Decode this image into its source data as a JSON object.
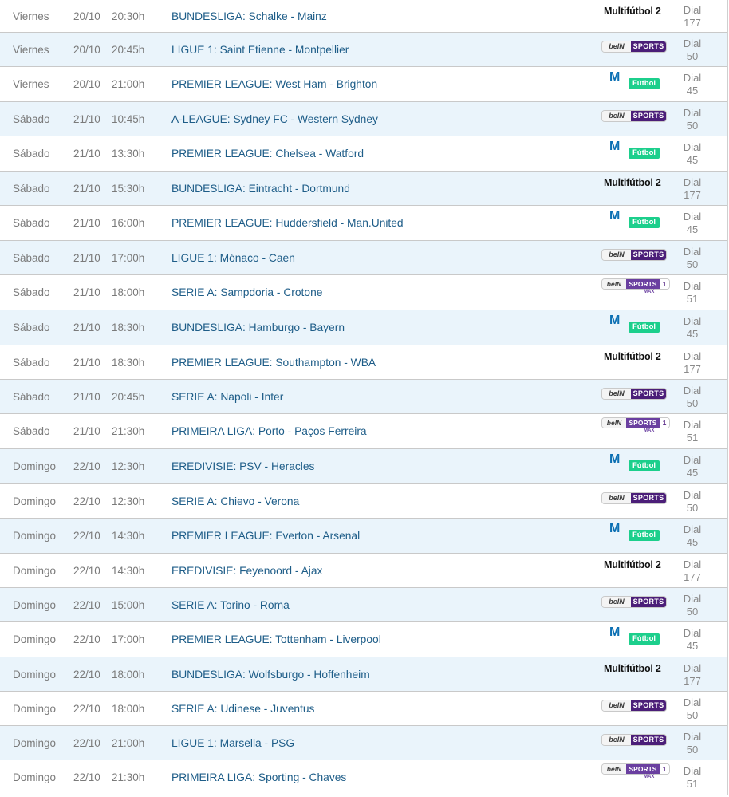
{
  "colors": {
    "row_alt": "#eaf4fb",
    "match_text": "#1e5d88",
    "bein_purple": "#4b1e78",
    "movistar_green": "#1ccf8c",
    "movistar_blue": "#0b6fb3"
  },
  "channels": {
    "multifutbol2": {
      "label": "Multifútbol 2",
      "icon": "multifutbol-2-logo"
    },
    "bein": {
      "label_left": "beIN",
      "label_right": "SPORTS",
      "icon": "bein-sports-logo"
    },
    "movistar": {
      "label_m": "M",
      "label_badge": "Fútbol",
      "icon": "movistar-futbol-logo"
    },
    "beinmax": {
      "label_left": "beIN",
      "label_mid": "SPORTS",
      "label_num": "1",
      "label_sub": "MAX",
      "icon": "bein-sports-max-1-logo"
    }
  },
  "rows": [
    {
      "day": "Viernes",
      "date": "20/10",
      "time": "20:30h",
      "match": "BUNDESLIGA: Schalke - Mainz",
      "channel": "multifutbol2",
      "dial_label": "Dial",
      "dial": "177"
    },
    {
      "day": "Viernes",
      "date": "20/10",
      "time": "20:45h",
      "match": "LIGUE 1: Saint Etienne - Montpellier",
      "channel": "bein",
      "dial_label": "Dial",
      "dial": "50"
    },
    {
      "day": "Viernes",
      "date": "20/10",
      "time": "21:00h",
      "match": "PREMIER LEAGUE: West Ham - Brighton",
      "channel": "movistar",
      "dial_label": "Dial",
      "dial": "45"
    },
    {
      "day": "Sábado",
      "date": "21/10",
      "time": "10:45h",
      "match": "A-LEAGUE: Sydney FC - Western Sydney",
      "channel": "bein",
      "dial_label": "Dial",
      "dial": "50"
    },
    {
      "day": "Sábado",
      "date": "21/10",
      "time": "13:30h",
      "match": "PREMIER LEAGUE: Chelsea - Watford",
      "channel": "movistar",
      "dial_label": "Dial",
      "dial": "45"
    },
    {
      "day": "Sábado",
      "date": "21/10",
      "time": "15:30h",
      "match": "BUNDESLIGA: Eintracht - Dortmund",
      "channel": "multifutbol2",
      "dial_label": "Dial",
      "dial": "177"
    },
    {
      "day": "Sábado",
      "date": "21/10",
      "time": "16:00h",
      "match": "PREMIER LEAGUE: Huddersfield - Man.United",
      "channel": "movistar",
      "dial_label": "Dial",
      "dial": "45"
    },
    {
      "day": "Sábado",
      "date": "21/10",
      "time": "17:00h",
      "match": "LIGUE 1: Mónaco - Caen",
      "channel": "bein",
      "dial_label": "Dial",
      "dial": "50"
    },
    {
      "day": "Sábado",
      "date": "21/10",
      "time": "18:00h",
      "match": "SERIE A: Sampdoria - Crotone",
      "channel": "beinmax",
      "dial_label": "Dial",
      "dial": "51"
    },
    {
      "day": "Sábado",
      "date": "21/10",
      "time": "18:30h",
      "match": "BUNDESLIGA: Hamburgo - Bayern",
      "channel": "movistar",
      "dial_label": "Dial",
      "dial": "45"
    },
    {
      "day": "Sábado",
      "date": "21/10",
      "time": "18:30h",
      "match": "PREMIER LEAGUE: Southampton - WBA",
      "channel": "multifutbol2",
      "dial_label": "Dial",
      "dial": "177"
    },
    {
      "day": "Sábado",
      "date": "21/10",
      "time": "20:45h",
      "match": "SERIE A: Napoli - Inter",
      "channel": "bein",
      "dial_label": "Dial",
      "dial": "50"
    },
    {
      "day": "Sábado",
      "date": "21/10",
      "time": "21:30h",
      "match": "PRIMEIRA LIGA: Porto - Paços Ferreira",
      "channel": "beinmax",
      "dial_label": "Dial",
      "dial": "51"
    },
    {
      "day": "Domingo",
      "date": "22/10",
      "time": "12:30h",
      "match": "EREDIVISIE: PSV - Heracles",
      "channel": "movistar",
      "dial_label": "Dial",
      "dial": "45"
    },
    {
      "day": "Domingo",
      "date": "22/10",
      "time": "12:30h",
      "match": "SERIE A: Chievo - Verona",
      "channel": "bein",
      "dial_label": "Dial",
      "dial": "50"
    },
    {
      "day": "Domingo",
      "date": "22/10",
      "time": "14:30h",
      "match": "PREMIER LEAGUE: Everton - Arsenal",
      "channel": "movistar",
      "dial_label": "Dial",
      "dial": "45"
    },
    {
      "day": "Domingo",
      "date": "22/10",
      "time": "14:30h",
      "match": "EREDIVISIE: Feyenoord - Ajax",
      "channel": "multifutbol2",
      "dial_label": "Dial",
      "dial": "177"
    },
    {
      "day": "Domingo",
      "date": "22/10",
      "time": "15:00h",
      "match": "SERIE A: Torino - Roma",
      "channel": "bein",
      "dial_label": "Dial",
      "dial": "50"
    },
    {
      "day": "Domingo",
      "date": "22/10",
      "time": "17:00h",
      "match": "PREMIER LEAGUE: Tottenham - Liverpool",
      "channel": "movistar",
      "dial_label": "Dial",
      "dial": "45"
    },
    {
      "day": "Domingo",
      "date": "22/10",
      "time": "18:00h",
      "match": "BUNDESLIGA: Wolfsburgo - Hoffenheim",
      "channel": "multifutbol2",
      "dial_label": "Dial",
      "dial": "177"
    },
    {
      "day": "Domingo",
      "date": "22/10",
      "time": "18:00h",
      "match": "SERIE A: Udinese - Juventus",
      "channel": "bein",
      "dial_label": "Dial",
      "dial": "50"
    },
    {
      "day": "Domingo",
      "date": "22/10",
      "time": "21:00h",
      "match": "LIGUE 1: Marsella - PSG",
      "channel": "bein",
      "dial_label": "Dial",
      "dial": "50"
    },
    {
      "day": "Domingo",
      "date": "22/10",
      "time": "21:30h",
      "match": "PRIMEIRA LIGA: Sporting - Chaves",
      "channel": "beinmax",
      "dial_label": "Dial",
      "dial": "51"
    }
  ]
}
